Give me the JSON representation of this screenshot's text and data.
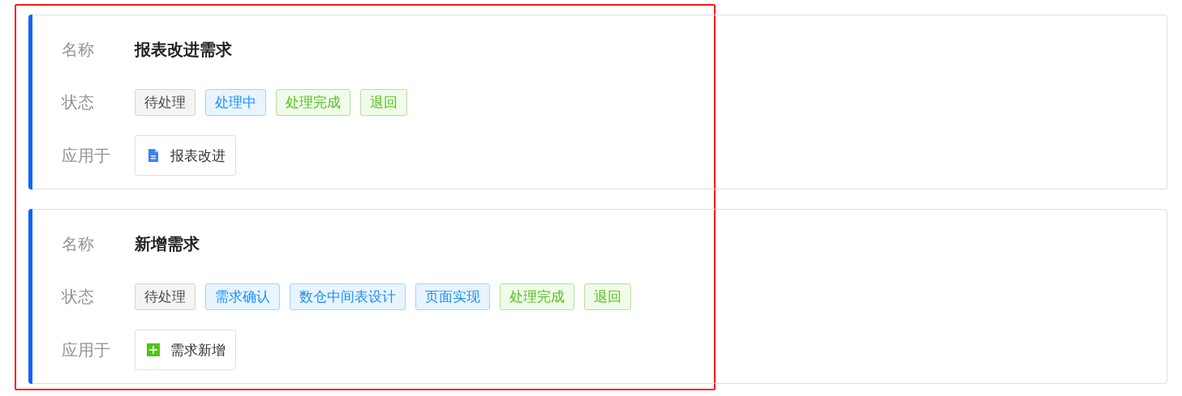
{
  "cards": [
    {
      "name_label": "名称",
      "name": "报表改进需求",
      "status_label": "状态",
      "statuses": [
        {
          "text": "待处理",
          "kind": "pending"
        },
        {
          "text": "处理中",
          "kind": "processing"
        },
        {
          "text": "处理完成",
          "kind": "done"
        },
        {
          "text": "退回",
          "kind": "done"
        }
      ],
      "applied_label": "应用于",
      "applied": {
        "text": "报表改进",
        "kind": "document"
      }
    },
    {
      "name_label": "名称",
      "name": "新增需求",
      "status_label": "状态",
      "statuses": [
        {
          "text": "待处理",
          "kind": "pending"
        },
        {
          "text": "需求确认",
          "kind": "processing"
        },
        {
          "text": "数仓中间表设计",
          "kind": "processing"
        },
        {
          "text": "页面实现",
          "kind": "processing"
        },
        {
          "text": "处理完成",
          "kind": "done"
        },
        {
          "text": "退回",
          "kind": "done"
        }
      ],
      "applied_label": "应用于",
      "applied": {
        "text": "需求新增",
        "kind": "add"
      }
    }
  ]
}
